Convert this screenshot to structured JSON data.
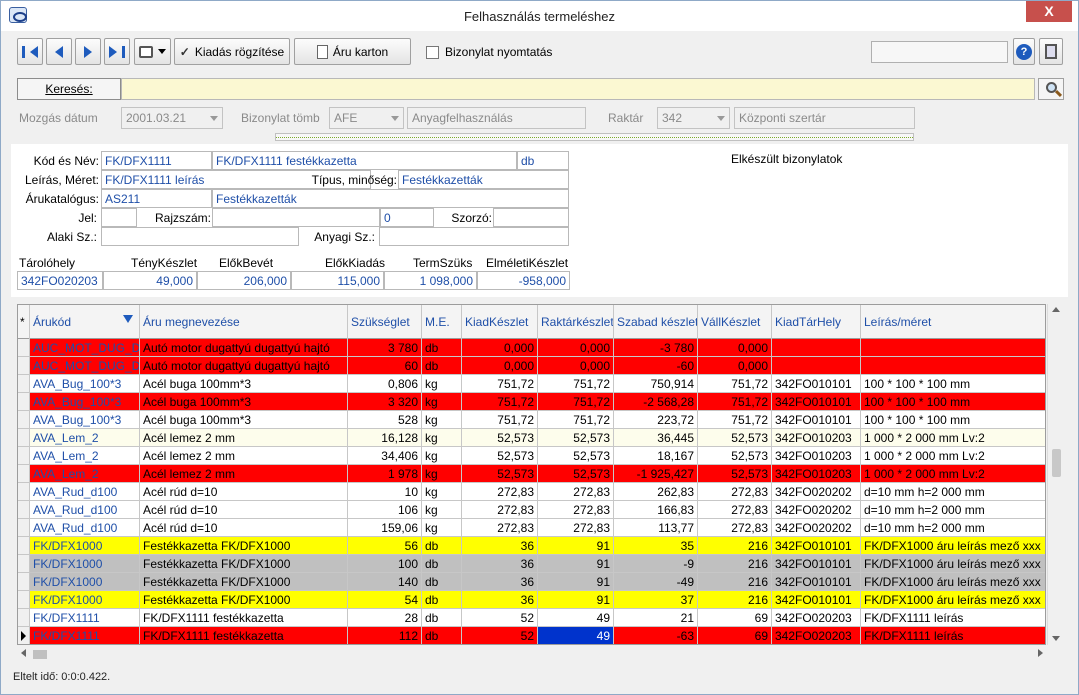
{
  "window": {
    "title": "Felhasználás termeléshez",
    "close_glyph": "X"
  },
  "toolbar": {
    "kiadas_label": "Kiadás rögzítése",
    "aru_karton_label": "Áru karton",
    "bizonylat_nyomtatas_label": "Bizonylat nyomtatás",
    "help_glyph": "?"
  },
  "search": {
    "label": "Keresés:",
    "value": ""
  },
  "filters": {
    "mozgas_datum_label": "Mozgás dátum",
    "mozgas_datum_value": "2001.03.21",
    "bizonylat_tomb_label": "Bizonylat tömb",
    "bizonylat_tomb_code": "AFE",
    "bizonylat_tomb_name": "Anyagfelhasználás",
    "raktar_label": "Raktár",
    "raktar_code": "342",
    "raktar_name": "Központi szertár"
  },
  "item": {
    "kod_nev_label": "Kód és Név:",
    "kod": "FK/DFX1111",
    "nev": "FK/DFX1111 festékkazetta",
    "me": "db",
    "leiras_meret_label": "Leírás, Méret:",
    "leiras": "FK/DFX1111 leírás",
    "tipus_label": "Típus, minőség:",
    "tipus": "Festékkazetták",
    "arukatalogus_label": "Árukatalógus:",
    "katalogus_kod": "AS211",
    "katalogus_nev": "Festékkazetták",
    "jel_label": "Jel:",
    "jel": "",
    "rajzszam_label": "Rajzszám:",
    "rajzszam": "",
    "rajzszam_num": "0",
    "szorzo_label": "Szorzó:",
    "szorzo": "",
    "alaki_label": "Alaki Sz.:",
    "alaki": "",
    "anyagi_label": "Anyagi Sz.:",
    "anyagi": "",
    "elkeszult": "Elkészült bizonylatok"
  },
  "stats": {
    "labels": [
      "Tárolóhely",
      "TényKészlet",
      "ElőkBevét",
      "ElőkKiadás",
      "TermSzüks",
      "ElméletiKészlet"
    ],
    "values": [
      "342FO020203",
      "49,000",
      "206,000",
      "115,000",
      "1 098,000",
      "-958,000"
    ]
  },
  "grid": {
    "star": "*",
    "columns": [
      "Árukód",
      "Áru megnevezése",
      "Szükséglet",
      "M.E.",
      "KiadKészlet",
      "Raktárkészlet",
      "Szabad készlet",
      "VállKészlet",
      "KiadTárHely",
      "Leírás/méret"
    ],
    "rows": [
      {
        "bg": "#ff0000",
        "fg": "#1f4fa8",
        "cells": [
          "AUC_MOT_DUG_DD",
          "Autó motor dugattyú dugattyú hajtó",
          "3 780",
          "db",
          "0,000",
          "0,000",
          "-3 780",
          "0,000",
          "",
          ""
        ]
      },
      {
        "bg": "#ff0000",
        "fg": "#1f4fa8",
        "cells": [
          "AUC_MOT_DUG_DD",
          "Autó motor dugattyú dugattyú hajtó",
          "60",
          "db",
          "0,000",
          "0,000",
          "-60",
          "0,000",
          "",
          ""
        ]
      },
      {
        "bg": "#ffffff",
        "fg": "#1f4fa8",
        "cells": [
          "AVA_Bug_100*3",
          "Acél buga 100mm*3",
          "0,806",
          "kg",
          "751,72",
          "751,72",
          "750,914",
          "751,72",
          "342FO010101",
          "100 * 100 * 100 mm"
        ]
      },
      {
        "bg": "#ff0000",
        "fg": "#1f4fa8",
        "cells": [
          "AVA_Bug_100*3",
          "Acél buga 100mm*3",
          "3 320",
          "kg",
          "751,72",
          "751,72",
          "-2 568,28",
          "751,72",
          "342FO010101",
          "100 * 100 * 100 mm"
        ]
      },
      {
        "bg": "#ffffff",
        "fg": "#1f4fa8",
        "cells": [
          "AVA_Bug_100*3",
          "Acél buga 100mm*3",
          "528",
          "kg",
          "751,72",
          "751,72",
          "223,72",
          "751,72",
          "342FO010101",
          "100 * 100 * 100 mm"
        ]
      },
      {
        "bg": "#fdfdec",
        "fg": "#1f4fa8",
        "cells": [
          "AVA_Lem_2",
          "Acél lemez 2 mm",
          "16,128",
          "kg",
          "52,573",
          "52,573",
          "36,445",
          "52,573",
          "342FO010203",
          "1 000 * 2 000 mm Lv:2"
        ]
      },
      {
        "bg": "#ffffff",
        "fg": "#1f4fa8",
        "cells": [
          "AVA_Lem_2",
          "Acél lemez 2 mm",
          "34,406",
          "kg",
          "52,573",
          "52,573",
          "18,167",
          "52,573",
          "342FO010203",
          "1 000 * 2 000 mm Lv:2"
        ]
      },
      {
        "bg": "#ff0000",
        "fg": "#1f4fa8",
        "cells": [
          "AVA_Lem_2",
          "Acél lemez 2 mm",
          "1 978",
          "kg",
          "52,573",
          "52,573",
          "-1 925,427",
          "52,573",
          "342FO010203",
          "1 000 * 2 000 mm Lv:2"
        ]
      },
      {
        "bg": "#ffffff",
        "fg": "#1f4fa8",
        "cells": [
          "AVA_Rud_d100",
          "Acél rúd d=10",
          "10",
          "kg",
          "272,83",
          "272,83",
          "262,83",
          "272,83",
          "342FO020202",
          "d=10 mm h=2 000 mm"
        ]
      },
      {
        "bg": "#ffffff",
        "fg": "#1f4fa8",
        "cells": [
          "AVA_Rud_d100",
          "Acél rúd d=10",
          "106",
          "kg",
          "272,83",
          "272,83",
          "166,83",
          "272,83",
          "342FO020202",
          "d=10 mm h=2 000 mm"
        ]
      },
      {
        "bg": "#ffffff",
        "fg": "#1f4fa8",
        "cells": [
          "AVA_Rud_d100",
          "Acél rúd d=10",
          "159,06",
          "kg",
          "272,83",
          "272,83",
          "113,77",
          "272,83",
          "342FO020202",
          "d=10 mm h=2 000 mm"
        ]
      },
      {
        "bg": "#ffff00",
        "fg": "#1f4fa8",
        "cells": [
          "FK/DFX1000",
          "Festékkazetta FK/DFX1000",
          "56",
          "db",
          "36",
          "91",
          "35",
          "216",
          "342FO010101",
          "FK/DFX1000 áru leírás mező xxx"
        ]
      },
      {
        "bg": "#c0c0c0",
        "fg": "#1f4fa8",
        "cells": [
          "FK/DFX1000",
          "Festékkazetta FK/DFX1000",
          "100",
          "db",
          "36",
          "91",
          "-9",
          "216",
          "342FO010101",
          "FK/DFX1000 áru leírás mező xxx"
        ]
      },
      {
        "bg": "#c0c0c0",
        "fg": "#1f4fa8",
        "cells": [
          "FK/DFX1000",
          "Festékkazetta FK/DFX1000",
          "140",
          "db",
          "36",
          "91",
          "-49",
          "216",
          "342FO010101",
          "FK/DFX1000 áru leírás mező xxx"
        ]
      },
      {
        "bg": "#ffff00",
        "fg": "#1f4fa8",
        "cells": [
          "FK/DFX1000",
          "Festékkazetta FK/DFX1000",
          "54",
          "db",
          "36",
          "91",
          "37",
          "216",
          "342FO010101",
          "FK/DFX1000 áru leírás mező xxx"
        ]
      },
      {
        "bg": "#ffffff",
        "fg": "#1f4fa8",
        "cells": [
          "FK/DFX1111",
          "FK/DFX1111 festékkazetta",
          "28",
          "db",
          "52",
          "49",
          "21",
          "69",
          "342FO020203",
          "FK/DFX1111 leírás"
        ]
      },
      {
        "bg": "#ff0000",
        "fg": "#1f4fa8",
        "current": true,
        "cells": [
          "FK/DFX1111",
          "FK/DFX1111 festékkazetta",
          "112",
          "db",
          "52",
          "49",
          "-63",
          "69",
          "342FO020203",
          "FK/DFX1111 leírás"
        ]
      }
    ]
  },
  "colors": {
    "selected_cell": "#0033cc",
    "link_blue": "#1f4fa8",
    "accent": "#1e5bbd"
  },
  "status": {
    "text": "Eltelt idő: 0:0:0.422."
  }
}
